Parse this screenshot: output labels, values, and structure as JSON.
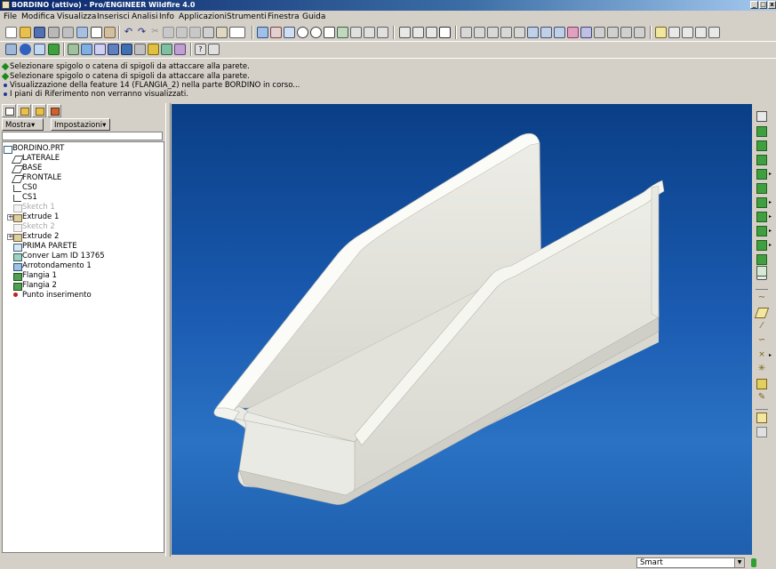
{
  "window": {
    "title": "BORDINO (attivo) - Pro/ENGINEER Wildfire 4.0",
    "minimize": "_",
    "maximize": "□",
    "close": "x"
  },
  "menu": [
    "File",
    "Modifica",
    "Visualizza",
    "Inserisci",
    "Analisi",
    "Info",
    "Applicazioni",
    "Strumenti",
    "Finestra",
    "Guida"
  ],
  "messages": [
    {
      "text": "Selezionare spigolo o catena di spigoli da attaccare alla parete.",
      "icon": "green-diamond-icon",
      "color": "#1a8a1a"
    },
    {
      "text": "Selezionare spigolo o catena di spigoli da attaccare alla parete.",
      "icon": "green-diamond-icon",
      "color": "#1a8a1a"
    },
    {
      "text": "Visualizzazione della feature 14 (FLANGIA_2) nella parte BORDINO in corso...",
      "icon": "blue-dot-icon",
      "color": "#1a3aa0"
    },
    {
      "text": "I piani di Riferimento non verranno visualizzati.",
      "icon": "blue-dot-icon",
      "color": "#1a3aa0"
    }
  ],
  "tree_panel": {
    "show_button": "Mostra",
    "settings_button": "Impostazioni",
    "items": [
      {
        "label": "BORDINO.PRT",
        "icon": "part-icon",
        "dim": false,
        "expandable": false
      },
      {
        "label": "LATERALE",
        "icon": "datum-plane-icon",
        "dim": false,
        "expandable": false
      },
      {
        "label": "BASE",
        "icon": "datum-plane-icon",
        "dim": false,
        "expandable": false
      },
      {
        "label": "FRONTALE",
        "icon": "datum-plane-icon",
        "dim": false,
        "expandable": false
      },
      {
        "label": "CS0",
        "icon": "coord-system-icon",
        "dim": false,
        "expandable": false
      },
      {
        "label": "CS1",
        "icon": "coord-system-icon",
        "dim": false,
        "expandable": false
      },
      {
        "label": "Sketch 1",
        "icon": "sketch-icon",
        "dim": true,
        "expandable": false
      },
      {
        "label": "Extrude 1",
        "icon": "extrude-icon",
        "dim": false,
        "expandable": true
      },
      {
        "label": "Sketch 2",
        "icon": "sketch-icon",
        "dim": true,
        "expandable": false
      },
      {
        "label": "Extrude 2",
        "icon": "extrude-icon",
        "dim": false,
        "expandable": true
      },
      {
        "label": "PRIMA PARETE",
        "icon": "wall-icon",
        "dim": false,
        "expandable": false
      },
      {
        "label": "Conver Lam ID 13765",
        "icon": "conversion-icon",
        "dim": false,
        "expandable": false
      },
      {
        "label": "Arrotondamento 1",
        "icon": "round-icon",
        "dim": false,
        "expandable": false
      },
      {
        "label": "Flangia 1",
        "icon": "flange-icon",
        "dim": false,
        "expandable": false
      },
      {
        "label": "Flangia 2",
        "icon": "flange-icon",
        "dim": false,
        "expandable": false
      },
      {
        "label": "Punto inserimento",
        "icon": "insert-point-icon",
        "dim": false,
        "expandable": false
      }
    ]
  },
  "status": {
    "selection_filter": "Smart",
    "dropdown_arrow": "▼"
  },
  "colors": {
    "viewport_top": "#0a3f86",
    "viewport_bottom": "#2a72c4",
    "model_face": "#ecece6",
    "model_shadow": "#c8c8c0",
    "chrome": "#d4d0c8"
  }
}
